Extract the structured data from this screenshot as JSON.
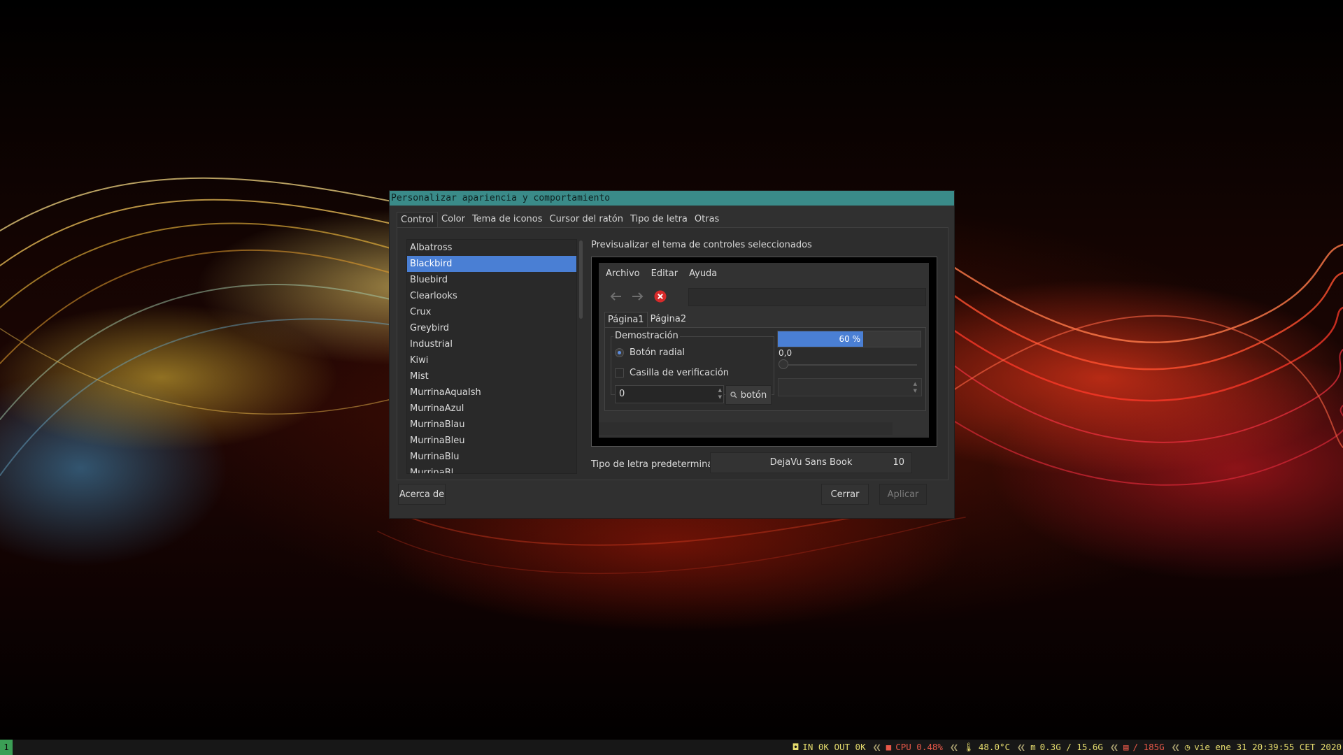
{
  "window": {
    "title": "Personalizar apariencia y comportamiento",
    "tabs": [
      "Control",
      "Color",
      "Tema de iconos",
      "Cursor del ratón",
      "Tipo de letra",
      "Otras"
    ],
    "theme_list": [
      "Albatross",
      "Blackbird",
      "Bluebird",
      "Clearlooks",
      "Crux",
      "Greybird",
      "Industrial",
      "Kiwi",
      "Mist",
      "MurrinaAquaIsh",
      "MurrinaAzul",
      "MurrinaBlau",
      "MurrinaBleu",
      "MurrinaBlu",
      "MurrinaBl..."
    ],
    "selected_theme": "Blackbird",
    "preview_label": "Previsualizar el tema de controles seleccionados",
    "preview": {
      "menu": [
        "Archivo",
        "Editar",
        "Ayuda"
      ],
      "tabs": [
        "Página1",
        "Página2"
      ],
      "frame_title": "Demostración",
      "radio_label": "Botón radial",
      "checkbox_label": "Casilla de verificación",
      "spin_value": "0",
      "button_label": "botón",
      "progress": 0.6,
      "progress_text": "60 %",
      "scale_value": "0,0"
    },
    "font_label": "Tipo de letra predeterminado:",
    "font_name": "DejaVu Sans Book",
    "font_size": "10",
    "about_button": "Acerca de",
    "close_button": "Cerrar",
    "apply_button": "Aplicar"
  },
  "panel": {
    "workspace": "1",
    "net": "IN 0K OUT 0K",
    "cpu": "CPU 0.48%",
    "temp": "48.0°C",
    "mem": "0.3G / 15.6G",
    "disk": "/ 185G",
    "clock": "vie ene 31 20:39:55 CET 2020"
  },
  "colors": {
    "accent": "#4a7fd4",
    "titlebar": "#3a8b89",
    "workspace": "#3b9e55"
  }
}
